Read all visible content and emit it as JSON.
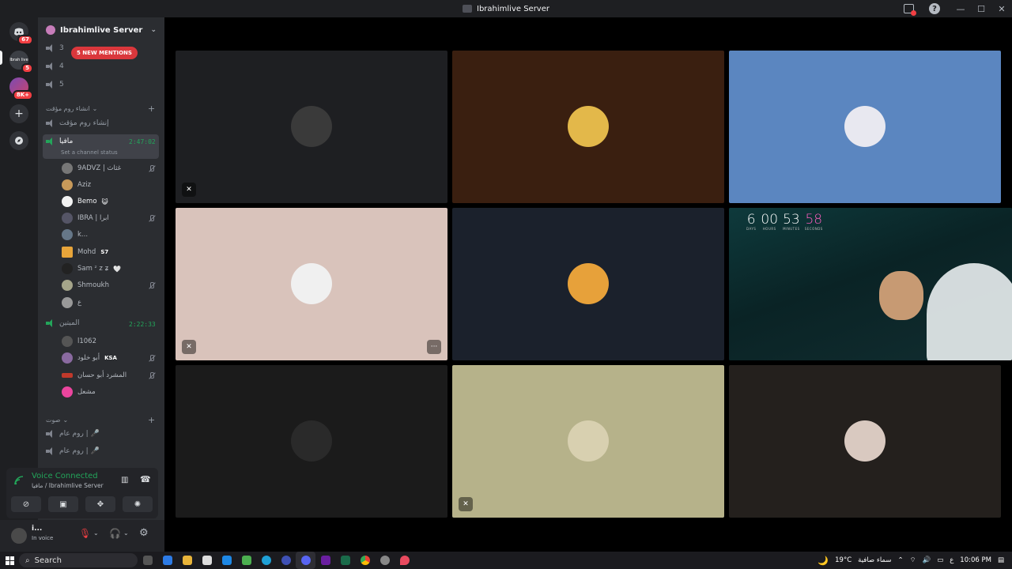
{
  "window": {
    "title": "Ibrahimlive Server"
  },
  "rail": {
    "home_badge": "67",
    "servers": [
      {
        "label": "Ibrah live",
        "badge": "5"
      },
      {
        "label": "",
        "badge": "8K+"
      }
    ]
  },
  "sidebar": {
    "server_name": "Ibrahimlive Server",
    "new_mentions": "5 NEW MENTIONS",
    "channels_top": [
      "3",
      "4",
      "5"
    ],
    "temp_category": "انشاء روم مؤقت",
    "temp_channel": "إنشاء روم مؤقت",
    "active_channel": {
      "name": "مافيا",
      "timer": "2:47:02",
      "status_placeholder": "Set a channel status",
      "members": [
        "9ADVZ | غثاث",
        "Aziz",
        "Bemo",
        "IBRA | ابرا",
        "k...",
        "Mohd",
        "Sam ᶻ z ʑ",
        "Shmoukh",
        "ع"
      ]
    },
    "second_channel": {
      "name": "الميتين",
      "timer": "2:22:33",
      "members": [
        "l1062",
        "أبو خلود",
        "المشرد أبو حسان",
        "مشعل"
      ]
    },
    "voice_category": "صوت",
    "voice_channels": [
      "روم عام | 🎤",
      "روم عام | 🎤"
    ],
    "badge_ksa": "KSA",
    "badge_s7": "S7"
  },
  "voice_panel": {
    "status": "Voice Connected",
    "location": "مافيا / Ibrahimlive Server"
  },
  "user": {
    "name": "i...",
    "status": "In voice"
  },
  "stream": {
    "countdown": [
      {
        "value": "6",
        "label": "DAYS"
      },
      {
        "value": "00",
        "label": "HOURS"
      },
      {
        "value": "53",
        "label": "MINUTES"
      },
      {
        "value": "58",
        "label": "SECONDS"
      }
    ]
  },
  "tile_colors": [
    "#1e1f22",
    "#3a1f10",
    "#5b86c0",
    "#d9c3bb",
    "#1b212c",
    "#0b2a2d",
    "#1b1b1b",
    "#b6b28a",
    "#24201d"
  ],
  "taskbar": {
    "search_placeholder": "Search",
    "weather": "19°C",
    "weather_text": "سماء صافية",
    "lang": "ع",
    "time": "10:06 PM"
  }
}
